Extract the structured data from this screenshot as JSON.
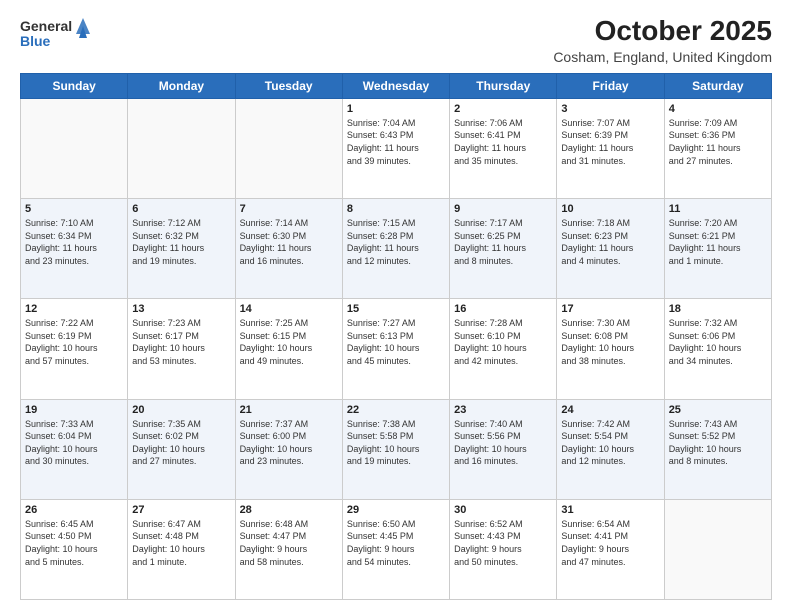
{
  "header": {
    "logo_general": "General",
    "logo_blue": "Blue",
    "month": "October 2025",
    "location": "Cosham, England, United Kingdom"
  },
  "days_of_week": [
    "Sunday",
    "Monday",
    "Tuesday",
    "Wednesday",
    "Thursday",
    "Friday",
    "Saturday"
  ],
  "weeks": [
    [
      {
        "day": "",
        "info": ""
      },
      {
        "day": "",
        "info": ""
      },
      {
        "day": "",
        "info": ""
      },
      {
        "day": "1",
        "info": "Sunrise: 7:04 AM\nSunset: 6:43 PM\nDaylight: 11 hours\nand 39 minutes."
      },
      {
        "day": "2",
        "info": "Sunrise: 7:06 AM\nSunset: 6:41 PM\nDaylight: 11 hours\nand 35 minutes."
      },
      {
        "day": "3",
        "info": "Sunrise: 7:07 AM\nSunset: 6:39 PM\nDaylight: 11 hours\nand 31 minutes."
      },
      {
        "day": "4",
        "info": "Sunrise: 7:09 AM\nSunset: 6:36 PM\nDaylight: 11 hours\nand 27 minutes."
      }
    ],
    [
      {
        "day": "5",
        "info": "Sunrise: 7:10 AM\nSunset: 6:34 PM\nDaylight: 11 hours\nand 23 minutes."
      },
      {
        "day": "6",
        "info": "Sunrise: 7:12 AM\nSunset: 6:32 PM\nDaylight: 11 hours\nand 19 minutes."
      },
      {
        "day": "7",
        "info": "Sunrise: 7:14 AM\nSunset: 6:30 PM\nDaylight: 11 hours\nand 16 minutes."
      },
      {
        "day": "8",
        "info": "Sunrise: 7:15 AM\nSunset: 6:28 PM\nDaylight: 11 hours\nand 12 minutes."
      },
      {
        "day": "9",
        "info": "Sunrise: 7:17 AM\nSunset: 6:25 PM\nDaylight: 11 hours\nand 8 minutes."
      },
      {
        "day": "10",
        "info": "Sunrise: 7:18 AM\nSunset: 6:23 PM\nDaylight: 11 hours\nand 4 minutes."
      },
      {
        "day": "11",
        "info": "Sunrise: 7:20 AM\nSunset: 6:21 PM\nDaylight: 11 hours\nand 1 minute."
      }
    ],
    [
      {
        "day": "12",
        "info": "Sunrise: 7:22 AM\nSunset: 6:19 PM\nDaylight: 10 hours\nand 57 minutes."
      },
      {
        "day": "13",
        "info": "Sunrise: 7:23 AM\nSunset: 6:17 PM\nDaylight: 10 hours\nand 53 minutes."
      },
      {
        "day": "14",
        "info": "Sunrise: 7:25 AM\nSunset: 6:15 PM\nDaylight: 10 hours\nand 49 minutes."
      },
      {
        "day": "15",
        "info": "Sunrise: 7:27 AM\nSunset: 6:13 PM\nDaylight: 10 hours\nand 45 minutes."
      },
      {
        "day": "16",
        "info": "Sunrise: 7:28 AM\nSunset: 6:10 PM\nDaylight: 10 hours\nand 42 minutes."
      },
      {
        "day": "17",
        "info": "Sunrise: 7:30 AM\nSunset: 6:08 PM\nDaylight: 10 hours\nand 38 minutes."
      },
      {
        "day": "18",
        "info": "Sunrise: 7:32 AM\nSunset: 6:06 PM\nDaylight: 10 hours\nand 34 minutes."
      }
    ],
    [
      {
        "day": "19",
        "info": "Sunrise: 7:33 AM\nSunset: 6:04 PM\nDaylight: 10 hours\nand 30 minutes."
      },
      {
        "day": "20",
        "info": "Sunrise: 7:35 AM\nSunset: 6:02 PM\nDaylight: 10 hours\nand 27 minutes."
      },
      {
        "day": "21",
        "info": "Sunrise: 7:37 AM\nSunset: 6:00 PM\nDaylight: 10 hours\nand 23 minutes."
      },
      {
        "day": "22",
        "info": "Sunrise: 7:38 AM\nSunset: 5:58 PM\nDaylight: 10 hours\nand 19 minutes."
      },
      {
        "day": "23",
        "info": "Sunrise: 7:40 AM\nSunset: 5:56 PM\nDaylight: 10 hours\nand 16 minutes."
      },
      {
        "day": "24",
        "info": "Sunrise: 7:42 AM\nSunset: 5:54 PM\nDaylight: 10 hours\nand 12 minutes."
      },
      {
        "day": "25",
        "info": "Sunrise: 7:43 AM\nSunset: 5:52 PM\nDaylight: 10 hours\nand 8 minutes."
      }
    ],
    [
      {
        "day": "26",
        "info": "Sunrise: 6:45 AM\nSunset: 4:50 PM\nDaylight: 10 hours\nand 5 minutes."
      },
      {
        "day": "27",
        "info": "Sunrise: 6:47 AM\nSunset: 4:48 PM\nDaylight: 10 hours\nand 1 minute."
      },
      {
        "day": "28",
        "info": "Sunrise: 6:48 AM\nSunset: 4:47 PM\nDaylight: 9 hours\nand 58 minutes."
      },
      {
        "day": "29",
        "info": "Sunrise: 6:50 AM\nSunset: 4:45 PM\nDaylight: 9 hours\nand 54 minutes."
      },
      {
        "day": "30",
        "info": "Sunrise: 6:52 AM\nSunset: 4:43 PM\nDaylight: 9 hours\nand 50 minutes."
      },
      {
        "day": "31",
        "info": "Sunrise: 6:54 AM\nSunset: 4:41 PM\nDaylight: 9 hours\nand 47 minutes."
      },
      {
        "day": "",
        "info": ""
      }
    ]
  ]
}
